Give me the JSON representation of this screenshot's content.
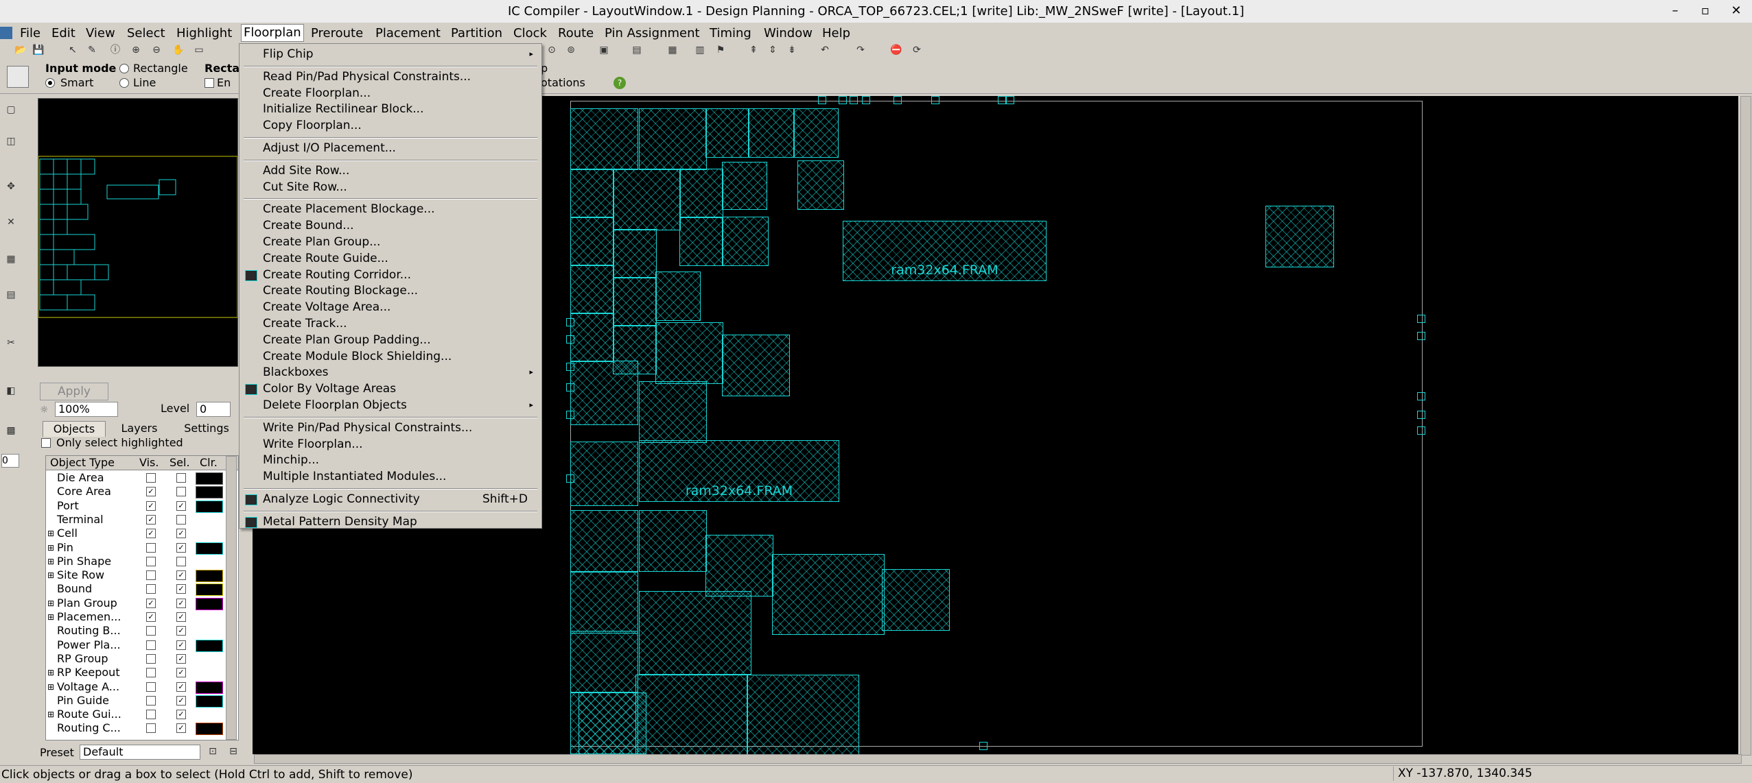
{
  "window": {
    "title": "IC Compiler - LayoutWindow.1 - Design Planning - ORCA_TOP_66723.CEL;1 [write]    Lib:_MW_2NSweF [write] - [Layout.1]",
    "minimize": "–",
    "restore": "▫",
    "close": "✕"
  },
  "menubar": [
    "File",
    "Edit",
    "View",
    "Select",
    "Highlight",
    "Floorplan",
    "Preroute",
    "Placement",
    "Partition",
    "Clock",
    "Route",
    "Pin Assignment",
    "Timing",
    "Window",
    "Help"
  ],
  "toolbar": {
    "input_mode_label": "Input mode",
    "rectangle": "Rectangle",
    "rect_short": "Recta",
    "smart": "Smart",
    "line": "Line",
    "en_short": "En",
    "p_short": "p",
    "annotations_short": "otations"
  },
  "left_panel": {
    "apply": "Apply",
    "zoom": "100%",
    "level_label": "Level",
    "level_value": "0",
    "side_field": "0",
    "tabs": [
      "Objects",
      "Layers",
      "Settings"
    ],
    "only_select_highlighted": "Only select highlighted",
    "table_headers": [
      "Object Type",
      "Vis.",
      "Sel.",
      "Clr."
    ],
    "objects": [
      {
        "name": "Die Area",
        "expand": false,
        "vis": false,
        "sel": false,
        "color": "#000000",
        "border": "#666666"
      },
      {
        "name": "Core Area",
        "expand": false,
        "vis": true,
        "sel": false,
        "color": "#000000",
        "border": "#666666"
      },
      {
        "name": "Port",
        "expand": false,
        "vis": true,
        "sel": true,
        "color": "#000000",
        "border": "#19d6d6"
      },
      {
        "name": "Terminal",
        "expand": false,
        "vis": true,
        "sel": false,
        "color": "",
        "border": ""
      },
      {
        "name": "Cell",
        "expand": true,
        "vis": true,
        "sel": true,
        "color": "",
        "border": ""
      },
      {
        "name": "Pin",
        "expand": true,
        "vis": false,
        "sel": true,
        "color": "#000000",
        "border": "#19d6d6"
      },
      {
        "name": "Pin Shape",
        "expand": true,
        "vis": false,
        "sel": false,
        "color": "",
        "border": ""
      },
      {
        "name": "Site Row",
        "expand": true,
        "vis": false,
        "sel": true,
        "color": "#000000",
        "border": "#c8a000"
      },
      {
        "name": "Bound",
        "expand": false,
        "vis": false,
        "sel": true,
        "color": "#000000",
        "border": "#d0d000"
      },
      {
        "name": "Plan Group",
        "expand": true,
        "vis": true,
        "sel": true,
        "color": "#000000",
        "border": "#d000d0"
      },
      {
        "name": "Placemen...",
        "expand": true,
        "vis": true,
        "sel": true,
        "color": "",
        "border": ""
      },
      {
        "name": "Routing B...",
        "expand": false,
        "vis": false,
        "sel": true,
        "color": "",
        "border": ""
      },
      {
        "name": "Power Pla...",
        "expand": false,
        "vis": false,
        "sel": true,
        "color": "#000000",
        "border": "#19d6d6"
      },
      {
        "name": "RP Group",
        "expand": false,
        "vis": false,
        "sel": true,
        "color": "",
        "border": ""
      },
      {
        "name": "RP Keepout",
        "expand": true,
        "vis": false,
        "sel": true,
        "color": "",
        "border": ""
      },
      {
        "name": "Voltage A...",
        "expand": true,
        "vis": false,
        "sel": true,
        "color": "#000000",
        "border": "#d000d0"
      },
      {
        "name": "Pin Guide",
        "expand": false,
        "vis": false,
        "sel": true,
        "color": "#000000",
        "border": "#19d6d6"
      },
      {
        "name": "Route Gui...",
        "expand": true,
        "vis": false,
        "sel": true,
        "color": "",
        "border": ""
      },
      {
        "name": "Routing C...",
        "expand": false,
        "vis": false,
        "sel": true,
        "color": "#000000",
        "border": "#c04000"
      }
    ],
    "preset_label": "Preset",
    "preset_value": "Default"
  },
  "floorplan_menu": {
    "items": [
      {
        "label": "Flip Chip",
        "submenu": true
      },
      {
        "sep": true
      },
      {
        "label": "Read Pin/Pad Physical Constraints..."
      },
      {
        "label": "Create Floorplan..."
      },
      {
        "label": "Initialize Rectilinear Block..."
      },
      {
        "label": "Copy Floorplan..."
      },
      {
        "sep": true
      },
      {
        "label": "Adjust I/O Placement..."
      },
      {
        "sep": true
      },
      {
        "label": "Add Site Row..."
      },
      {
        "label": "Cut Site Row..."
      },
      {
        "sep": true
      },
      {
        "label": "Create Placement Blockage..."
      },
      {
        "label": "Create Bound..."
      },
      {
        "label": "Create Plan Group..."
      },
      {
        "label": "Create Route Guide..."
      },
      {
        "label": "Create Routing Corridor...",
        "icon": true
      },
      {
        "label": "Create Routing Blockage..."
      },
      {
        "label": "Create Voltage Area..."
      },
      {
        "label": "Create Track..."
      },
      {
        "label": "Create Plan Group Padding..."
      },
      {
        "label": "Create Module Block Shielding..."
      },
      {
        "label": "Blackboxes",
        "submenu": true
      },
      {
        "label": "Color By Voltage Areas",
        "icon": true
      },
      {
        "label": "Delete Floorplan Objects",
        "submenu": true
      },
      {
        "sep": true
      },
      {
        "label": "Write Pin/Pad Physical Constraints..."
      },
      {
        "label": "Write Floorplan..."
      },
      {
        "label": "Minchip..."
      },
      {
        "label": "Multiple Instantiated Modules..."
      },
      {
        "sep": true
      },
      {
        "label": "Analyze Logic Connectivity",
        "shortcut": "Shift+D",
        "icon": true
      },
      {
        "sep": true
      },
      {
        "label": "Metal Pattern Density Map",
        "icon": true
      }
    ]
  },
  "canvas": {
    "ram_label_1": "ram32x64.FRAM",
    "ram_label_2": "ram32x64.FRAM"
  },
  "status": {
    "message": "Click objects or drag a box to select (Hold Ctrl to add, Shift to remove)",
    "coords": "XY -137.870, 1340.345"
  }
}
